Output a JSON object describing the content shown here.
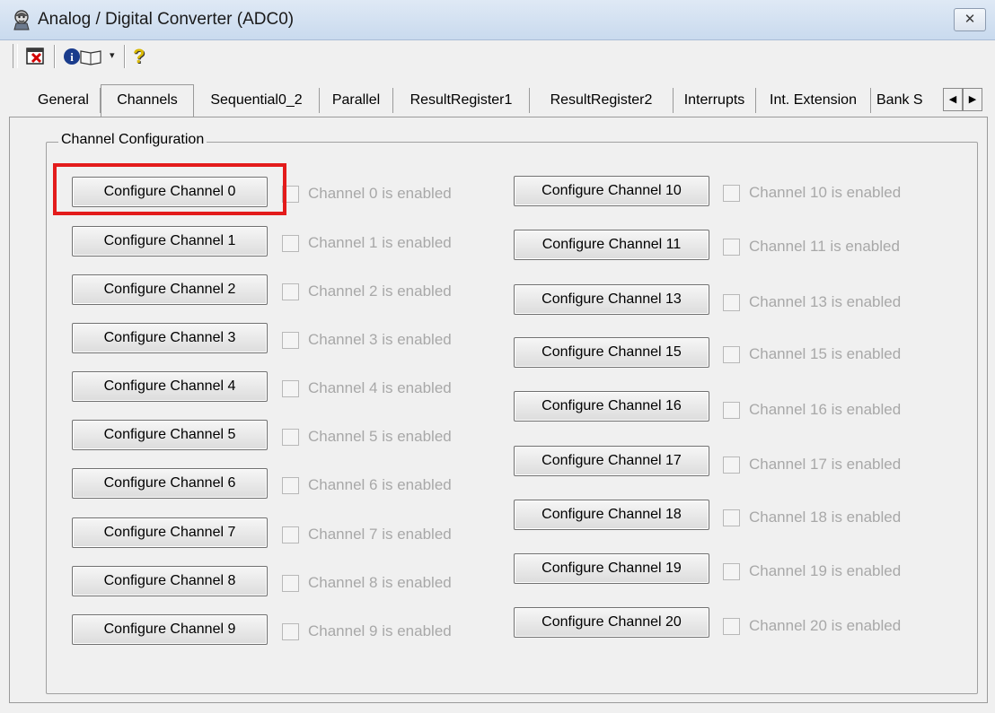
{
  "window": {
    "title": "Analog / Digital Converter  (ADC0)",
    "close_glyph": "✕"
  },
  "toolbar": {
    "icons": [
      "close-window-icon",
      "info-book-icon",
      "help-icon"
    ],
    "help_glyph": "?",
    "dropdown_glyph": "▾"
  },
  "tabs": {
    "items": [
      {
        "label": "General",
        "active": false
      },
      {
        "label": "Channels",
        "active": true
      },
      {
        "label": "Sequential0_2",
        "active": false
      },
      {
        "label": "Parallel",
        "active": false
      },
      {
        "label": "ResultRegister1",
        "active": false
      },
      {
        "label": "ResultRegister2",
        "active": false
      },
      {
        "label": "Interrupts",
        "active": false
      },
      {
        "label": "Int. Extension",
        "active": false
      },
      {
        "label": "Bank S",
        "active": false
      }
    ],
    "scroll_left": "◀",
    "scroll_right": "▶"
  },
  "group": {
    "title": "Channel Configuration"
  },
  "left_channels": [
    {
      "button": "Configure Channel 0",
      "checkbox": "Channel 0 is enabled",
      "checked": false,
      "highlighted": true
    },
    {
      "button": "Configure Channel 1",
      "checkbox": "Channel 1 is enabled",
      "checked": false
    },
    {
      "button": "Configure Channel 2",
      "checkbox": "Channel 2 is enabled",
      "checked": false
    },
    {
      "button": "Configure Channel 3",
      "checkbox": "Channel 3 is enabled",
      "checked": false
    },
    {
      "button": "Configure Channel 4",
      "checkbox": "Channel 4 is enabled",
      "checked": false
    },
    {
      "button": "Configure Channel 5",
      "checkbox": "Channel 5 is enabled",
      "checked": false
    },
    {
      "button": "Configure Channel 6",
      "checkbox": "Channel 6 is enabled",
      "checked": false
    },
    {
      "button": "Configure Channel 7",
      "checkbox": "Channel 7 is enabled",
      "checked": false
    },
    {
      "button": "Configure Channel 8",
      "checkbox": "Channel 8 is enabled",
      "checked": false
    },
    {
      "button": "Configure Channel 9",
      "checkbox": "Channel 9 is enabled",
      "checked": false
    }
  ],
  "right_channels": [
    {
      "button": "Configure Channel 10",
      "checkbox": "Channel 10 is enabled",
      "checked": false
    },
    {
      "button": "Configure Channel 11",
      "checkbox": "Channel 11 is enabled",
      "checked": false
    },
    {
      "button": "Configure Channel 13",
      "checkbox": "Channel 13 is enabled",
      "checked": false
    },
    {
      "button": "Configure Channel 15",
      "checkbox": "Channel 15 is enabled",
      "checked": false
    },
    {
      "button": "Configure Channel 16",
      "checkbox": "Channel 16 is enabled",
      "checked": false
    },
    {
      "button": "Configure Channel 17",
      "checkbox": "Channel 17 is enabled",
      "checked": false
    },
    {
      "button": "Configure Channel 18",
      "checkbox": "Channel 18 is enabled",
      "checked": false
    },
    {
      "button": "Configure Channel 19",
      "checkbox": "Channel 19 is enabled",
      "checked": false
    },
    {
      "button": "Configure Channel 20",
      "checkbox": "Channel 20 is enabled",
      "checked": false
    }
  ],
  "colors": {
    "highlight": "#e31b1b",
    "disabled_text": "#a8a8a8"
  }
}
